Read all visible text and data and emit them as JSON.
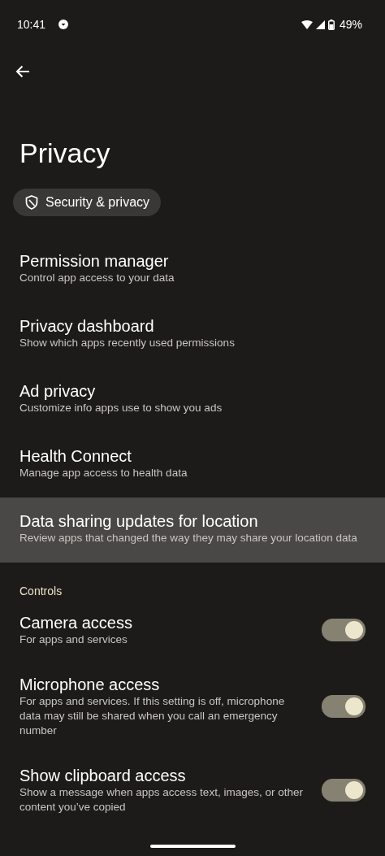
{
  "status_bar": {
    "time": "10:41",
    "battery": "49%"
  },
  "title": "Privacy",
  "chip": {
    "label": "Security & privacy"
  },
  "items": [
    {
      "title": "Permission manager",
      "subtitle": "Control app access to your data",
      "selected": false
    },
    {
      "title": "Privacy dashboard",
      "subtitle": "Show which apps recently used permissions",
      "selected": false
    },
    {
      "title": "Ad privacy",
      "subtitle": "Customize info apps use to show you ads",
      "selected": false
    },
    {
      "title": "Health Connect",
      "subtitle": "Manage app access to health data",
      "selected": false
    },
    {
      "title": "Data sharing updates for location",
      "subtitle": "Review apps that changed the way they may share your location data",
      "selected": true
    }
  ],
  "controls": {
    "header": "Controls",
    "items": [
      {
        "title": "Camera access",
        "subtitle": "For apps and services",
        "on": true
      },
      {
        "title": "Microphone access",
        "subtitle": "For apps and services. If this setting is off, microphone data may still be shared when you call an emergency number",
        "on": true
      },
      {
        "title": "Show clipboard access",
        "subtitle": "Show a message when apps access text, images, or other content you’ve copied",
        "on": true
      }
    ]
  }
}
